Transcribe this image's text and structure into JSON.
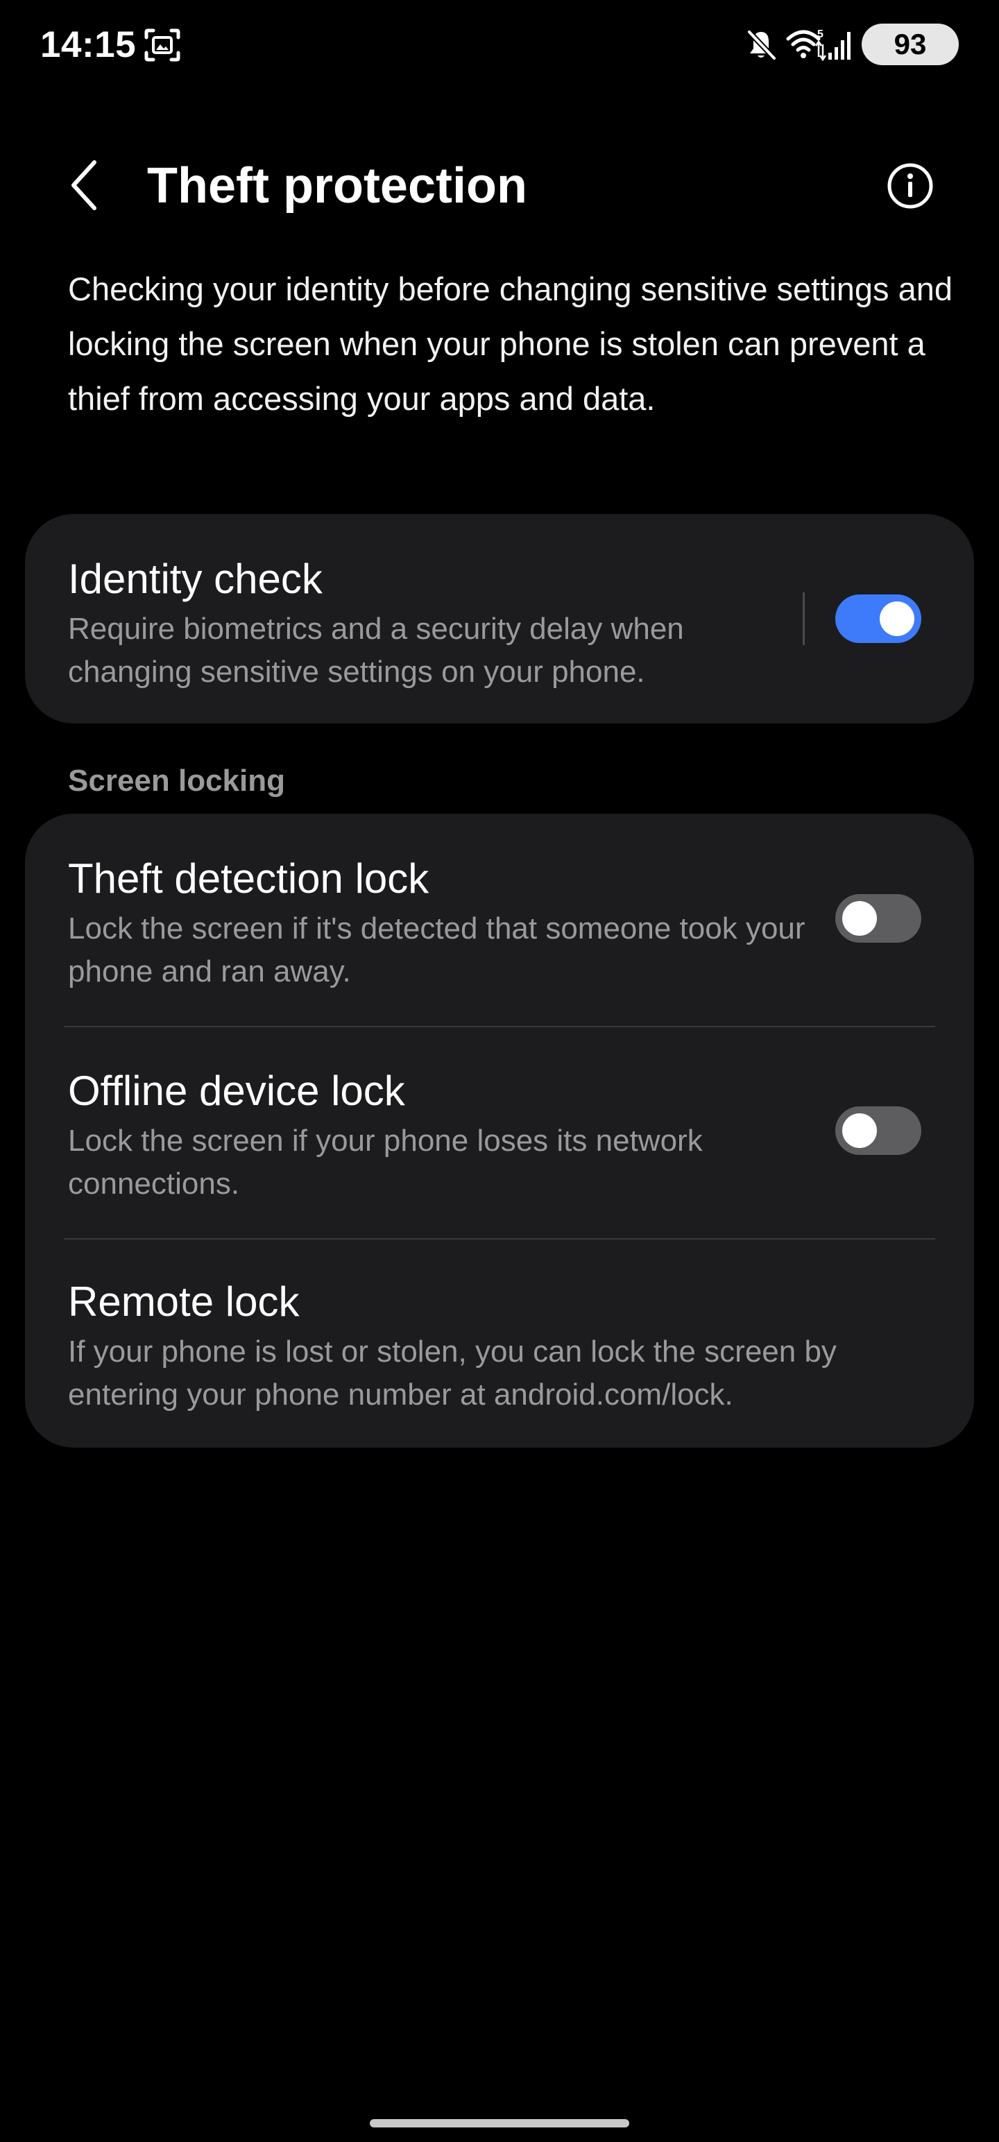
{
  "status_bar": {
    "time": "14:15",
    "battery": "93",
    "icons": [
      "screenshot-icon",
      "mute-icon",
      "wifi-icon",
      "signal-icon"
    ]
  },
  "header": {
    "title": "Theft protection",
    "back_icon": "chevron-left-icon",
    "info_icon": "info-icon"
  },
  "description": "Checking your identity before changing sensitive settings and locking the screen when your phone is stolen can prevent a thief from accessing your apps and data.",
  "identity_check": {
    "title": "Identity check",
    "subtitle": "Require biometrics and a security delay when changing sensitive settings on your phone.",
    "enabled": true
  },
  "screen_locking": {
    "header": "Screen locking",
    "items": [
      {
        "title": "Theft detection lock",
        "subtitle": "Lock the screen if it's detected that someone took your phone and ran away.",
        "enabled": false
      },
      {
        "title": "Offline device lock",
        "subtitle": "Lock the screen if your phone loses its network connections.",
        "enabled": false
      },
      {
        "title": "Remote lock",
        "subtitle": "If your phone is lost or stolen, you can lock the screen by entering your phone number at android.com/lock."
      }
    ]
  },
  "colors": {
    "background": "#000000",
    "card": "#1c1c1e",
    "accent": "#3e7bfa",
    "secondary_text": "#9a9a9c",
    "toggle_off": "#5d5d60"
  }
}
